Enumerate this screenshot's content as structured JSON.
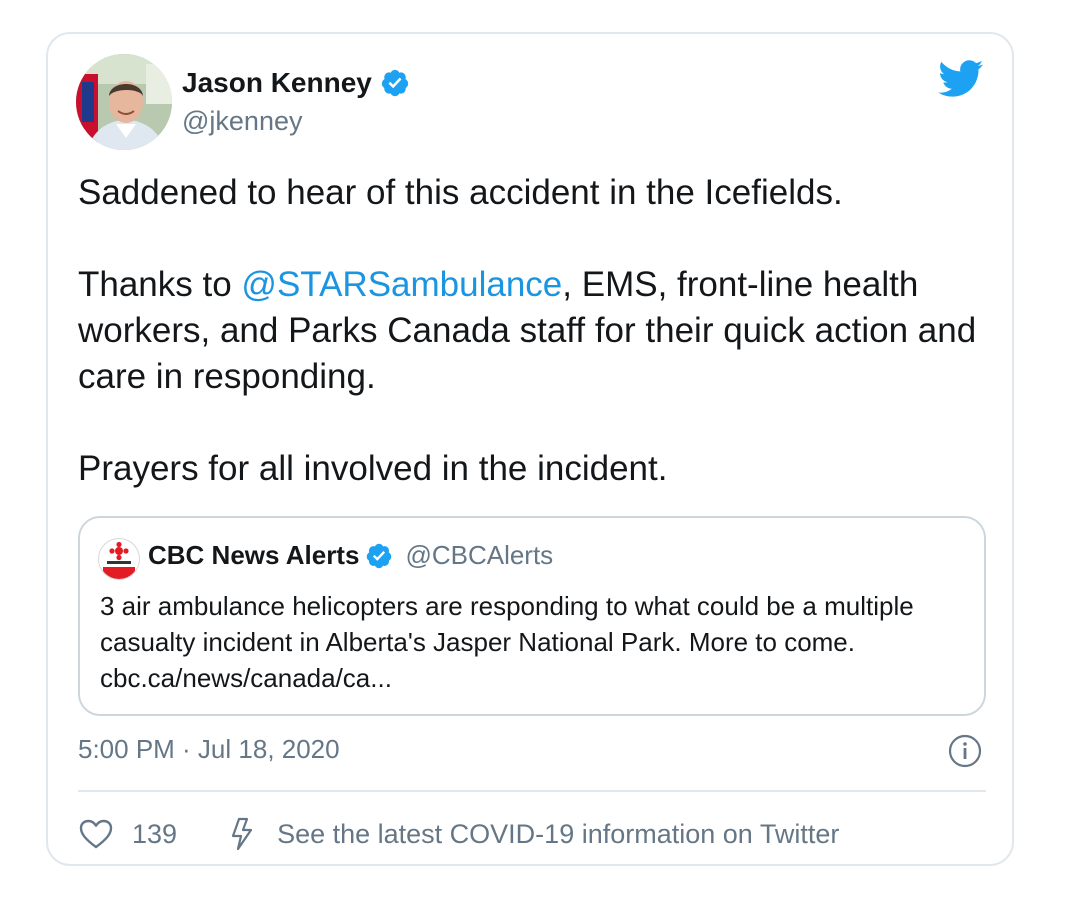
{
  "tweet": {
    "author_name": "Jason Kenney",
    "author_handle": "@jkenney",
    "verified": true,
    "text": {
      "line1": "Saddened to hear of this accident in the Icefields.",
      "para2_prefix": "Thanks to ",
      "para2_mention": "@STARSambulance",
      "para2_rest": ", EMS, front-line health workers, and Parks Canada staff for their quick action and care in responding.",
      "line3": "Prayers for all involved in the incident."
    },
    "timestamp": "5:00 PM · Jul 18, 2020"
  },
  "quoted_tweet": {
    "author_name": "CBC News Alerts",
    "author_handle": "@CBCAlerts",
    "verified": true,
    "text": "3 air ambulance helicopters are responding to what could be a multiple casualty incident in Alberta's Jasper National Park. More to come. cbc.ca/news/canada/ca..."
  },
  "actions": {
    "like_count": "139",
    "covid_info": "See the latest COVID-19 information on Twitter"
  },
  "icons": {
    "brand": "twitter-bird-icon",
    "verified": "verified-badge-icon",
    "like": "heart-icon",
    "info": "info-icon",
    "covid": "lightning-bolt-icon"
  },
  "colors": {
    "twitter_blue": "#1da1f2",
    "mention_blue": "#1b95e0",
    "secondary_text": "#657786",
    "border": "#e1e8ed",
    "cbc_red": "#e31b23"
  }
}
